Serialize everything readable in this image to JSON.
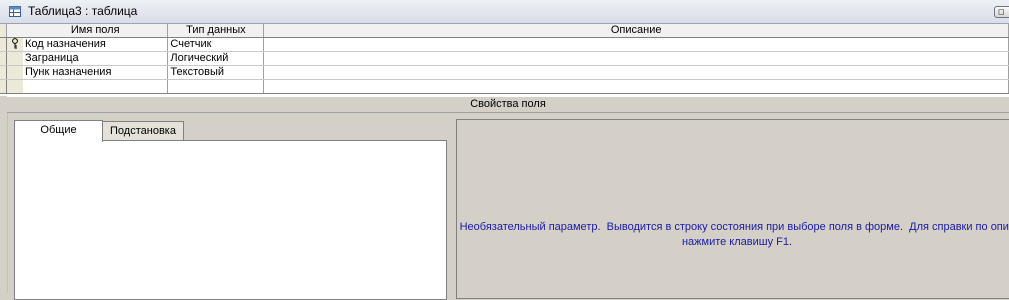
{
  "window": {
    "title": "Таблица3 : таблица",
    "restore_glyph": "◻"
  },
  "grid": {
    "columns": [
      "Имя поля",
      "Тип данных",
      "Описание"
    ],
    "rows": [
      {
        "name": "Код назначения",
        "type": "Счетчик",
        "description": "",
        "primary_key": true
      },
      {
        "name": "Заграница",
        "type": "Логический",
        "description": "",
        "primary_key": false
      },
      {
        "name": "Пунк назначения",
        "type": "Текстовый",
        "description": "",
        "primary_key": false
      },
      {
        "name": "",
        "type": "",
        "description": "",
        "primary_key": false
      }
    ]
  },
  "properties": {
    "header": "Свойства поля",
    "tabs": [
      "Общие",
      "Подстановка"
    ],
    "active_tab": "Общие"
  },
  "help": {
    "text_line1": "Необязательный параметр.  Выводится в строку состояния при выборе поля в форме.  Для справки по опис",
    "text_line2": "нажмите клавишу F1."
  },
  "colors": {
    "help_text": "#1a1aa6",
    "window_bg": "#d4d0c8"
  }
}
